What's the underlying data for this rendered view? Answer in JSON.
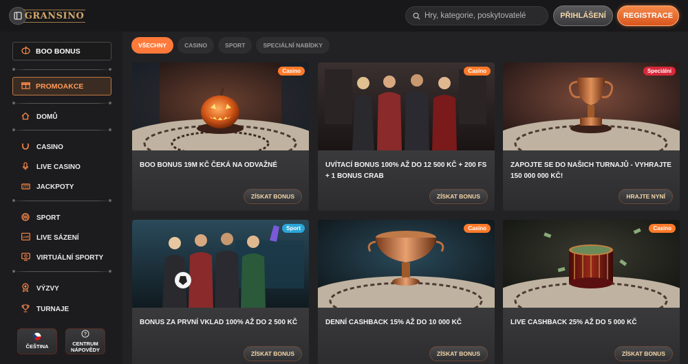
{
  "header": {
    "logo_text": "GRANSINO",
    "search_placeholder": "Hry, kategorie, poskytovatelé",
    "login_label": "PŘIHLÁŠENÍ",
    "register_label": "REGISTRACE"
  },
  "sidebar": {
    "boo_bonus": "BOO BONUS",
    "promo": "PROMOAKCE",
    "items": [
      {
        "label": "DOMŮ",
        "icon": "home-icon"
      },
      {
        "label": "CASINO",
        "icon": "horseshoe-icon"
      },
      {
        "label": "LIVE CASINO",
        "icon": "microphone-icon"
      },
      {
        "label": "JACKPOTY",
        "icon": "jackpot-icon"
      },
      {
        "label": "SPORT",
        "icon": "basketball-icon"
      },
      {
        "label": "LIVE SÁZENÍ",
        "icon": "live-icon"
      },
      {
        "label": "VIRTUÁLNÍ SPORTY",
        "icon": "monitor-icon"
      },
      {
        "label": "VÝZVY",
        "icon": "medal-icon"
      },
      {
        "label": "TURNAJE",
        "icon": "trophy-icon"
      }
    ],
    "language_label": "ČEŠTINA",
    "help_label": "CENTRUM NÁPOVĚDY"
  },
  "filters": [
    "VŠECHNY",
    "CASINO",
    "SPORT",
    "SPECIÁLNÍ NABÍDKY"
  ],
  "cards": [
    {
      "badge": "Casino",
      "title": "BOO BONUS 19M KČ ČEKÁ NA ODVAŽNÉ",
      "button": "ZÍSKAT BONUS"
    },
    {
      "badge": "Casino",
      "title": "UVÍTACÍ BONUS 100% AŽ DO 12 500 KČ + 200 FS + 1 BONUS CRAB",
      "button": "ZÍSKAT BONUS"
    },
    {
      "badge": "Speciální",
      "title": "ZAPOJTE SE DO NAŠICH TURNAJŮ - VYHRAJTE 150 000 000 KČ!",
      "button": "HRAJTE NYNÍ"
    },
    {
      "badge": "Sport",
      "title": "BONUS ZA PRVNÍ VKLAD 100% AŽ DO 2 500 KČ",
      "button": "ZÍSKAT BONUS"
    },
    {
      "badge": "Casino",
      "title": "DENNÍ CASHBACK 15% AŽ DO 10 000 KČ",
      "button": "ZÍSKAT BONUS"
    },
    {
      "badge": "Casino",
      "title": "LIVE CASHBACK 25% AŽ DO 5 000 KČ",
      "button": "ZÍSKAT BONUS"
    }
  ],
  "colors": {
    "accent": "#ff7a3a",
    "sport_badge": "#2ba6d9",
    "special_badge": "#d8283a"
  }
}
